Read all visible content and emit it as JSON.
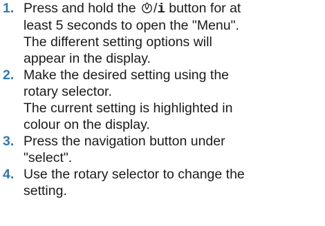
{
  "steps": [
    {
      "number": "1.",
      "pre_icon": "Press and hold the ",
      "icon": "eco-power-icon",
      "button_suffix": "/",
      "info_glyph": "i",
      "post_icon": " button for at",
      "lines": [
        "least 5 seconds to open the \"Menu\".",
        "The different setting options will",
        "appear in the display."
      ]
    },
    {
      "number": "2.",
      "lines": [
        "Make the desired setting using the",
        "rotary selector.",
        "The current setting is highlighted in",
        "colour on the display."
      ]
    },
    {
      "number": "3.",
      "lines": [
        "Press the navigation button under",
        "\"select\"."
      ]
    },
    {
      "number": "4.",
      "lines": [
        "Use the rotary selector to change the",
        "setting."
      ]
    }
  ],
  "colors": {
    "step_number": "#2f78b9",
    "text": "#1a1a1a"
  }
}
